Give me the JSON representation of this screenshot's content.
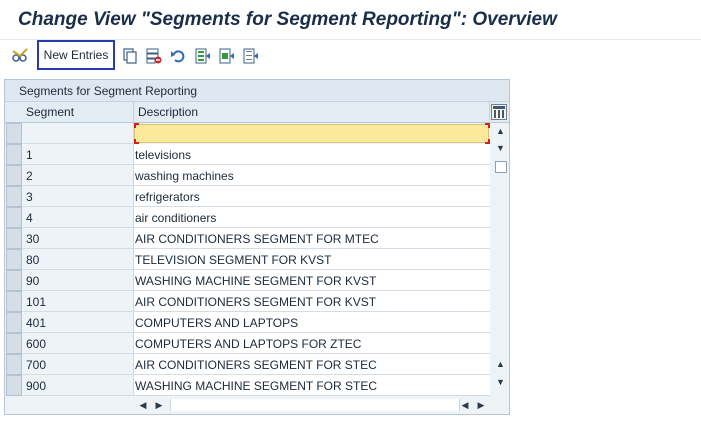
{
  "title": "Change View \"Segments for Segment Reporting\": Overview",
  "toolbar": {
    "new_entries_label": "New Entries",
    "icons": [
      "display-change-icon",
      "copy-as-icon",
      "delete-icon",
      "undo-change-icon",
      "select-all-icon",
      "select-block-icon",
      "deselect-all-icon"
    ]
  },
  "table": {
    "title": "Segments for Segment Reporting",
    "columns": [
      "Segment",
      "Description"
    ],
    "new_row": {
      "segment": "",
      "description": ""
    },
    "rows": [
      {
        "segment": "1",
        "description": "televisions"
      },
      {
        "segment": "2",
        "description": "washing machines"
      },
      {
        "segment": "3",
        "description": "refrigerators"
      },
      {
        "segment": "4",
        "description": "air conditioners"
      },
      {
        "segment": "30",
        "description": "AIR CONDITIONERS SEGMENT FOR MTEC"
      },
      {
        "segment": "80",
        "description": "TELEVISION SEGMENT FOR KVST"
      },
      {
        "segment": "90",
        "description": "WASHING MACHINE SEGMENT FOR KVST"
      },
      {
        "segment": "101",
        "description": "AIR CONDITIONERS SEGMENT FOR KVST"
      },
      {
        "segment": "401",
        "description": "COMPUTERS AND LAPTOPS"
      },
      {
        "segment": "600",
        "description": "COMPUTERS AND LAPTOPS FOR ZTEC"
      },
      {
        "segment": "700",
        "description": "AIR CONDITIONERS SEGMENT FOR STEC"
      },
      {
        "segment": "900",
        "description": "WASHING MACHINE SEGMENT FOR STEC"
      }
    ]
  },
  "colors": {
    "title": "#1a2e4a",
    "focus_border": "#2a3ca8",
    "input_highlight": "#fde99a",
    "panel_bg": "#eef3f8"
  }
}
